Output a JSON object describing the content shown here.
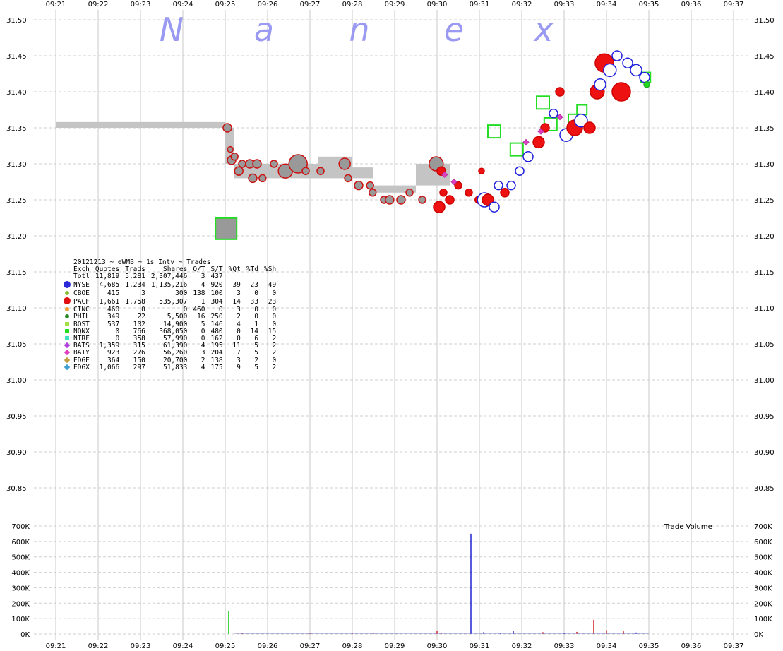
{
  "watermark": [
    "N",
    "a",
    "n",
    "e",
    "x"
  ],
  "chart_data": {
    "type": "scatter",
    "x_ticks": [
      "09:21",
      "09:22",
      "09:23",
      "09:24",
      "09:25",
      "09:26",
      "09:27",
      "09:28",
      "09:29",
      "09:30",
      "09:31",
      "09:32",
      "09:33",
      "09:34",
      "09:35",
      "09:36",
      "09:37"
    ],
    "y_ticks": [
      "31.50",
      "31.45",
      "31.40",
      "31.35",
      "31.30",
      "31.25",
      "31.20",
      "31.15",
      "31.10",
      "31.05",
      "31.00",
      "30.95",
      "30.90",
      "30.85"
    ],
    "ylim": [
      30.83,
      31.5
    ],
    "vol_ticks": [
      "700K",
      "600K",
      "500K",
      "400K",
      "300K",
      "200K",
      "100K",
      "0K"
    ],
    "vol_ylim": [
      0,
      700000
    ],
    "volume_label": "Trade Volume",
    "grid": true,
    "nbbo_band": [
      {
        "t0": 9.21,
        "t1": 9.25,
        "lo": 31.35,
        "hi": 31.358
      },
      {
        "t0": 9.25,
        "t1": 9.252,
        "lo": 31.3,
        "hi": 31.35
      },
      {
        "t0": 9.252,
        "t1": 9.262,
        "lo": 31.28,
        "hi": 31.3
      },
      {
        "t0": 9.262,
        "t1": 9.272,
        "lo": 31.28,
        "hi": 31.3
      },
      {
        "t0": 9.272,
        "t1": 9.28,
        "lo": 31.28,
        "hi": 31.31
      },
      {
        "t0": 9.28,
        "t1": 9.285,
        "lo": 31.28,
        "hi": 31.295
      },
      {
        "t0": 9.285,
        "t1": 9.295,
        "lo": 31.26,
        "hi": 31.27
      },
      {
        "t0": 9.295,
        "t1": 9.3,
        "lo": 31.27,
        "hi": 31.3
      },
      {
        "t0": 9.3,
        "t1": 9.303,
        "lo": 31.27,
        "hi": 31.3
      }
    ],
    "trades": [
      {
        "t": 9.2505,
        "p": 31.35,
        "s": 6,
        "c": "gray"
      },
      {
        "t": 9.2512,
        "p": 31.32,
        "s": 4,
        "c": "gray"
      },
      {
        "t": 9.2515,
        "p": 31.305,
        "s": 6,
        "c": "gray"
      },
      {
        "t": 9.2522,
        "p": 31.31,
        "s": 5,
        "c": "gray"
      },
      {
        "t": 9.2532,
        "p": 31.29,
        "s": 6,
        "c": "gray"
      },
      {
        "t": 9.254,
        "p": 31.3,
        "s": 5,
        "c": "gray"
      },
      {
        "t": 9.2558,
        "p": 31.3,
        "s": 6,
        "c": "gray"
      },
      {
        "t": 9.2565,
        "p": 31.28,
        "s": 6,
        "c": "gray"
      },
      {
        "t": 9.2575,
        "p": 31.3,
        "s": 6,
        "c": "gray"
      },
      {
        "t": 9.2588,
        "p": 31.28,
        "s": 5,
        "c": "gray"
      },
      {
        "t": 9.2615,
        "p": 31.3,
        "s": 5,
        "c": "gray"
      },
      {
        "t": 9.2642,
        "p": 31.29,
        "s": 10,
        "c": "gray"
      },
      {
        "t": 9.2672,
        "p": 31.3,
        "s": 13,
        "c": "gray"
      },
      {
        "t": 9.269,
        "p": 31.29,
        "s": 5,
        "c": "gray"
      },
      {
        "t": 9.2725,
        "p": 31.29,
        "s": 5,
        "c": "gray"
      },
      {
        "t": 9.2782,
        "p": 31.3,
        "s": 8,
        "c": "gray"
      },
      {
        "t": 9.279,
        "p": 31.28,
        "s": 5,
        "c": "gray"
      },
      {
        "t": 9.2815,
        "p": 31.27,
        "s": 6,
        "c": "gray"
      },
      {
        "t": 9.2842,
        "p": 31.27,
        "s": 5,
        "c": "gray"
      },
      {
        "t": 9.2848,
        "p": 31.26,
        "s": 5,
        "c": "gray"
      },
      {
        "t": 9.2875,
        "p": 31.25,
        "s": 5,
        "c": "gray"
      },
      {
        "t": 9.2888,
        "p": 31.25,
        "s": 6,
        "c": "gray"
      },
      {
        "t": 9.2915,
        "p": 31.25,
        "s": 6,
        "c": "gray"
      },
      {
        "t": 9.2935,
        "p": 31.26,
        "s": 5,
        "c": "gray"
      },
      {
        "t": 9.2965,
        "p": 31.25,
        "s": 5,
        "c": "gray"
      },
      {
        "t": 9.2998,
        "p": 31.3,
        "s": 10,
        "c": "gray"
      },
      {
        "t": 9.3005,
        "p": 31.24,
        "s": 8,
        "c": "red"
      },
      {
        "t": 9.301,
        "p": 31.29,
        "s": 6,
        "c": "red"
      },
      {
        "t": 9.3015,
        "p": 31.26,
        "s": 5,
        "c": "red"
      },
      {
        "t": 9.303,
        "p": 31.25,
        "s": 6,
        "c": "red"
      },
      {
        "t": 9.305,
        "p": 31.27,
        "s": 5,
        "c": "red"
      },
      {
        "t": 9.3075,
        "p": 31.26,
        "s": 5,
        "c": "red"
      },
      {
        "t": 9.3098,
        "p": 31.25,
        "s": 5,
        "c": "red"
      },
      {
        "t": 9.3105,
        "p": 31.29,
        "s": 4,
        "c": "red"
      },
      {
        "t": 9.3112,
        "p": 31.25,
        "s": 10,
        "c": "blue"
      },
      {
        "t": 9.312,
        "p": 31.25,
        "s": 8,
        "c": "red"
      },
      {
        "t": 9.3135,
        "p": 31.24,
        "s": 7,
        "c": "blue"
      },
      {
        "t": 9.3145,
        "p": 31.27,
        "s": 6,
        "c": "blue"
      },
      {
        "t": 9.316,
        "p": 31.26,
        "s": 6,
        "c": "red"
      },
      {
        "t": 9.3175,
        "p": 31.27,
        "s": 6,
        "c": "blue"
      },
      {
        "t": 9.3195,
        "p": 31.29,
        "s": 6,
        "c": "blue"
      },
      {
        "t": 9.3215,
        "p": 31.31,
        "s": 7,
        "c": "blue"
      },
      {
        "t": 9.324,
        "p": 31.33,
        "s": 8,
        "c": "red"
      },
      {
        "t": 9.3255,
        "p": 31.35,
        "s": 6,
        "c": "red"
      },
      {
        "t": 9.3275,
        "p": 31.37,
        "s": 6,
        "c": "blue"
      },
      {
        "t": 9.329,
        "p": 31.4,
        "s": 6,
        "c": "red"
      },
      {
        "t": 9.3305,
        "p": 31.34,
        "s": 9,
        "c": "blue"
      },
      {
        "t": 9.3325,
        "p": 31.35,
        "s": 11,
        "c": "red"
      },
      {
        "t": 9.334,
        "p": 31.36,
        "s": 9,
        "c": "blue"
      },
      {
        "t": 9.336,
        "p": 31.35,
        "s": 8,
        "c": "red"
      },
      {
        "t": 9.3378,
        "p": 31.4,
        "s": 10,
        "c": "red"
      },
      {
        "t": 9.3385,
        "p": 31.41,
        "s": 8,
        "c": "blue"
      },
      {
        "t": 9.3395,
        "p": 31.44,
        "s": 13,
        "c": "red"
      },
      {
        "t": 9.3408,
        "p": 31.43,
        "s": 9,
        "c": "blue"
      },
      {
        "t": 9.3425,
        "p": 31.45,
        "s": 7,
        "c": "blue"
      },
      {
        "t": 9.3435,
        "p": 31.4,
        "s": 13,
        "c": "red"
      },
      {
        "t": 9.345,
        "p": 31.44,
        "s": 7,
        "c": "blue"
      },
      {
        "t": 9.347,
        "p": 31.43,
        "s": 8,
        "c": "blue"
      },
      {
        "t": 9.349,
        "p": 31.42,
        "s": 7,
        "c": "blue"
      },
      {
        "t": 9.3495,
        "p": 31.41,
        "s": 4,
        "c": "green"
      }
    ],
    "green_boxes": [
      {
        "t": 9.2502,
        "p": 31.21,
        "s": 15
      },
      {
        "t": 9.3135,
        "p": 31.345,
        "s": 9
      },
      {
        "t": 9.3188,
        "p": 31.32,
        "s": 9
      },
      {
        "t": 9.325,
        "p": 31.385,
        "s": 9
      },
      {
        "t": 9.3268,
        "p": 31.355,
        "s": 9
      },
      {
        "t": 9.3325,
        "p": 31.36,
        "s": 9
      },
      {
        "t": 9.3342,
        "p": 31.375,
        "s": 7
      },
      {
        "t": 9.3492,
        "p": 31.42,
        "s": 7
      }
    ],
    "pink_diamonds": [
      {
        "t": 9.3018,
        "p": 31.285
      },
      {
        "t": 9.304,
        "p": 31.275
      },
      {
        "t": 9.321,
        "p": 31.33
      },
      {
        "t": 9.3245,
        "p": 31.345
      },
      {
        "t": 9.329,
        "p": 31.365
      }
    ],
    "volume": [
      {
        "t": 9.2508,
        "v": 150000,
        "c": "#22cc22"
      },
      {
        "t": 9.254,
        "v": 5000,
        "c": "#cc0000"
      },
      {
        "t": 9.27,
        "v": 6000,
        "c": "#cc0000"
      },
      {
        "t": 9.28,
        "v": 5000,
        "c": "#cc0000"
      },
      {
        "t": 9.285,
        "v": 4000,
        "c": "#cc0000"
      },
      {
        "t": 9.3,
        "v": 22000,
        "c": "#cc0000"
      },
      {
        "t": 9.301,
        "v": 8000,
        "c": "#cc0000"
      },
      {
        "t": 9.308,
        "v": 650000,
        "c": "#0000cc"
      },
      {
        "t": 9.311,
        "v": 12000,
        "c": "#0000cc"
      },
      {
        "t": 9.315,
        "v": 8000,
        "c": "#0000cc"
      },
      {
        "t": 9.318,
        "v": 18000,
        "c": "#0000cc"
      },
      {
        "t": 9.325,
        "v": 12000,
        "c": "#cc0000"
      },
      {
        "t": 9.33,
        "v": 8000,
        "c": "#0000cc"
      },
      {
        "t": 9.333,
        "v": 14000,
        "c": "#cc0000"
      },
      {
        "t": 9.337,
        "v": 92000,
        "c": "#cc0000"
      },
      {
        "t": 9.34,
        "v": 25000,
        "c": "#cc0000"
      },
      {
        "t": 9.344,
        "v": 18000,
        "c": "#cc0000"
      },
      {
        "t": 9.347,
        "v": 10000,
        "c": "#0000cc"
      }
    ]
  },
  "stats": {
    "title": "20121213 ~ eWMB ~ 1s Intv ~ Trades",
    "columns": [
      "Exch",
      "Quotes",
      "Trads",
      "Shares",
      "Q/T",
      "S/T",
      "%Qt",
      "%Td",
      "%Sh"
    ],
    "rows": [
      {
        "exch": "Totl",
        "marker": "",
        "color": "",
        "vals": [
          "11,819",
          "5,281",
          "2,307,446",
          "3",
          "437",
          "",
          "",
          ""
        ]
      },
      {
        "exch": "NYSE",
        "marker": "circle",
        "color": "#2a2ad8",
        "vals": [
          "4,685",
          "1,234",
          "1,135,216",
          "4",
          "920",
          "39",
          "23",
          "49"
        ]
      },
      {
        "exch": "CBOE",
        "marker": "dot",
        "color": "#8fbf3f",
        "vals": [
          "415",
          "3",
          "300",
          "138",
          "100",
          "3",
          "0",
          "0"
        ]
      },
      {
        "exch": "PACF",
        "marker": "circle",
        "color": "#e01010",
        "vals": [
          "1,661",
          "1,758",
          "535,307",
          "1",
          "304",
          "14",
          "33",
          "23"
        ]
      },
      {
        "exch": "CINC",
        "marker": "dot",
        "color": "#f0a030",
        "vals": [
          "460",
          "0",
          "0",
          "460",
          "0",
          "3",
          "0",
          "0"
        ]
      },
      {
        "exch": "PHIL",
        "marker": "dot",
        "color": "#2a8a2a",
        "vals": [
          "349",
          "22",
          "5,500",
          "16",
          "250",
          "2",
          "0",
          "0"
        ]
      },
      {
        "exch": "BOST",
        "marker": "square",
        "color": "#a0e040",
        "vals": [
          "537",
          "102",
          "14,900",
          "5",
          "146",
          "4",
          "1",
          "0"
        ]
      },
      {
        "exch": "NQNX",
        "marker": "square",
        "color": "#22dd22",
        "vals": [
          "0",
          "766",
          "368,050",
          "0",
          "480",
          "0",
          "14",
          "15"
        ]
      },
      {
        "exch": "NTRF",
        "marker": "square",
        "color": "#40e0c0",
        "vals": [
          "0",
          "358",
          "57,990",
          "0",
          "162",
          "0",
          "6",
          "2"
        ]
      },
      {
        "exch": "BATS",
        "marker": "diamond",
        "color": "#b040e0",
        "vals": [
          "1,359",
          "315",
          "61,390",
          "4",
          "195",
          "11",
          "5",
          "2"
        ]
      },
      {
        "exch": "BATY",
        "marker": "diamond",
        "color": "#e040c0",
        "vals": [
          "923",
          "276",
          "56,260",
          "3",
          "204",
          "7",
          "5",
          "2"
        ]
      },
      {
        "exch": "EDGE",
        "marker": "diamond",
        "color": "#c0a040",
        "vals": [
          "364",
          "150",
          "20,700",
          "2",
          "138",
          "3",
          "2",
          "0"
        ]
      },
      {
        "exch": "EDGX",
        "marker": "diamond",
        "color": "#40a0d0",
        "vals": [
          "1,066",
          "297",
          "51,833",
          "4",
          "175",
          "9",
          "5",
          "2"
        ]
      }
    ]
  }
}
